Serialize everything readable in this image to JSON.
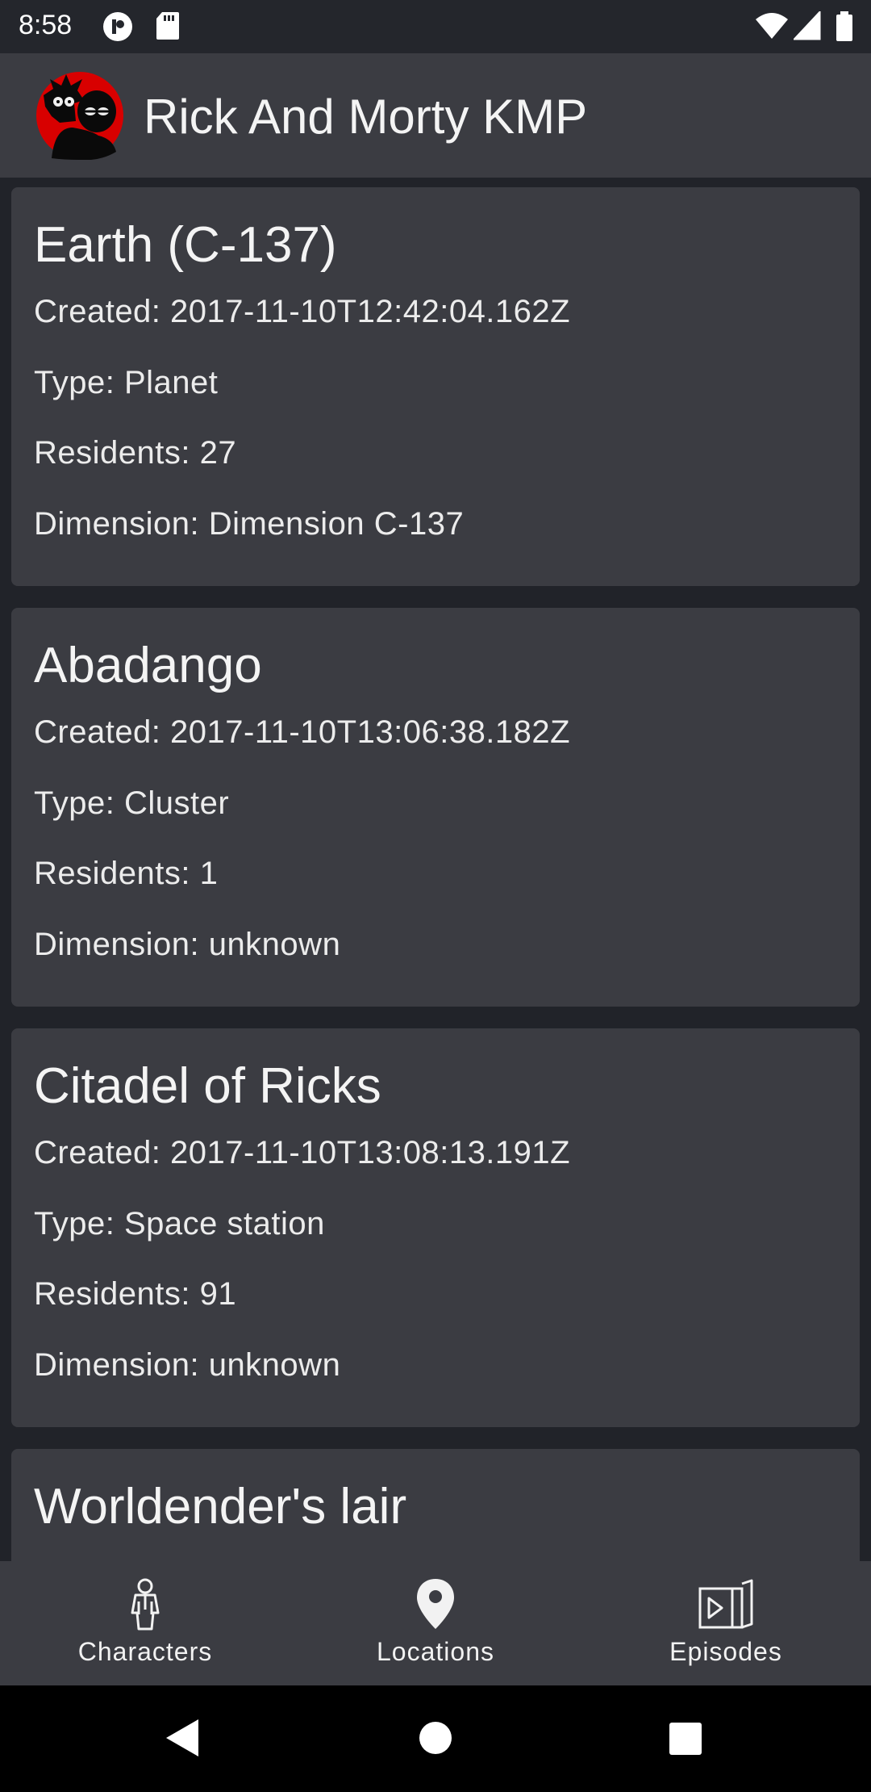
{
  "status_bar": {
    "time": "8:58",
    "icons": [
      "privacy-icon",
      "sd-card-icon",
      "wifi-icon",
      "signal-icon",
      "battery-icon"
    ]
  },
  "app_bar": {
    "title": "Rick And Morty KMP",
    "logo": "rick-morty-logo",
    "accent_color": "#e00000"
  },
  "locations": [
    {
      "name": "Earth (C-137)",
      "created": "Created: 2017-11-10T12:42:04.162Z",
      "type": "Type: Planet",
      "residents": "Residents: 27",
      "dimension": "Dimension: Dimension C-137"
    },
    {
      "name": "Abadango",
      "created": "Created: 2017-11-10T13:06:38.182Z",
      "type": "Type: Cluster",
      "residents": "Residents: 1",
      "dimension": "Dimension: unknown"
    },
    {
      "name": "Citadel of Ricks",
      "created": "Created: 2017-11-10T13:08:13.191Z",
      "type": "Type: Space station",
      "residents": "Residents: 91",
      "dimension": "Dimension: unknown"
    },
    {
      "name": "Worldender's lair"
    }
  ],
  "bottom_nav": {
    "items": [
      {
        "label": "Characters",
        "icon": "character-icon"
      },
      {
        "label": "Locations",
        "icon": "location-pin-icon"
      },
      {
        "label": "Episodes",
        "icon": "episodes-icon"
      }
    ]
  },
  "system_nav": {
    "icons": [
      "back-icon",
      "home-icon",
      "recents-icon"
    ]
  }
}
